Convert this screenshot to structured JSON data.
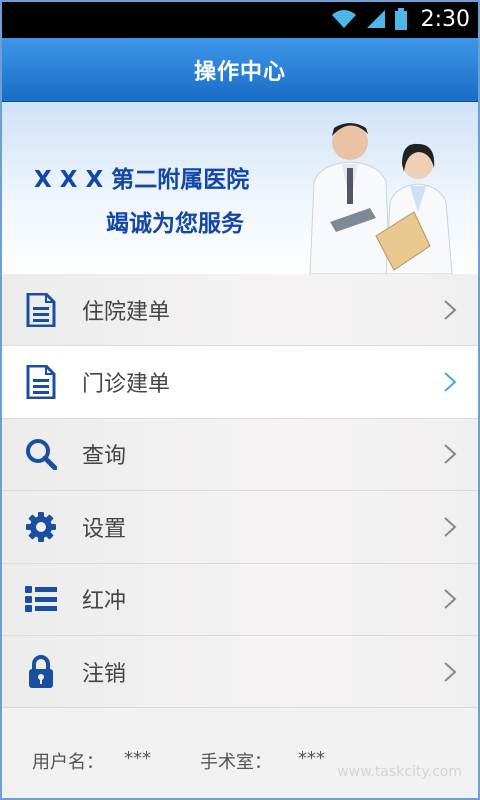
{
  "status_bar": {
    "time": "2:30",
    "icons": [
      "wifi-icon",
      "signal-icon",
      "battery-icon"
    ]
  },
  "header": {
    "title": "操作中心"
  },
  "banner": {
    "line1": "X X X 第二附属医院",
    "line2": "竭诚为您服务"
  },
  "menu": {
    "items": [
      {
        "label": "住院建单",
        "icon": "document-icon"
      },
      {
        "label": "门诊建单",
        "icon": "document-icon",
        "active": true
      },
      {
        "label": "查询",
        "icon": "search-icon"
      },
      {
        "label": "设置",
        "icon": "gear-icon"
      },
      {
        "label": "红冲",
        "icon": "list-icon"
      },
      {
        "label": "注销",
        "icon": "lock-icon"
      }
    ]
  },
  "footer": {
    "user_label": "用户名：",
    "user_value": "***",
    "room_label": "手术室：",
    "room_value": "***",
    "watermark": "www.taskcity.com"
  },
  "colors": {
    "header": "#2a83dc",
    "accent": "#1a4fa0",
    "chevron_active": "#4aa8d8"
  }
}
